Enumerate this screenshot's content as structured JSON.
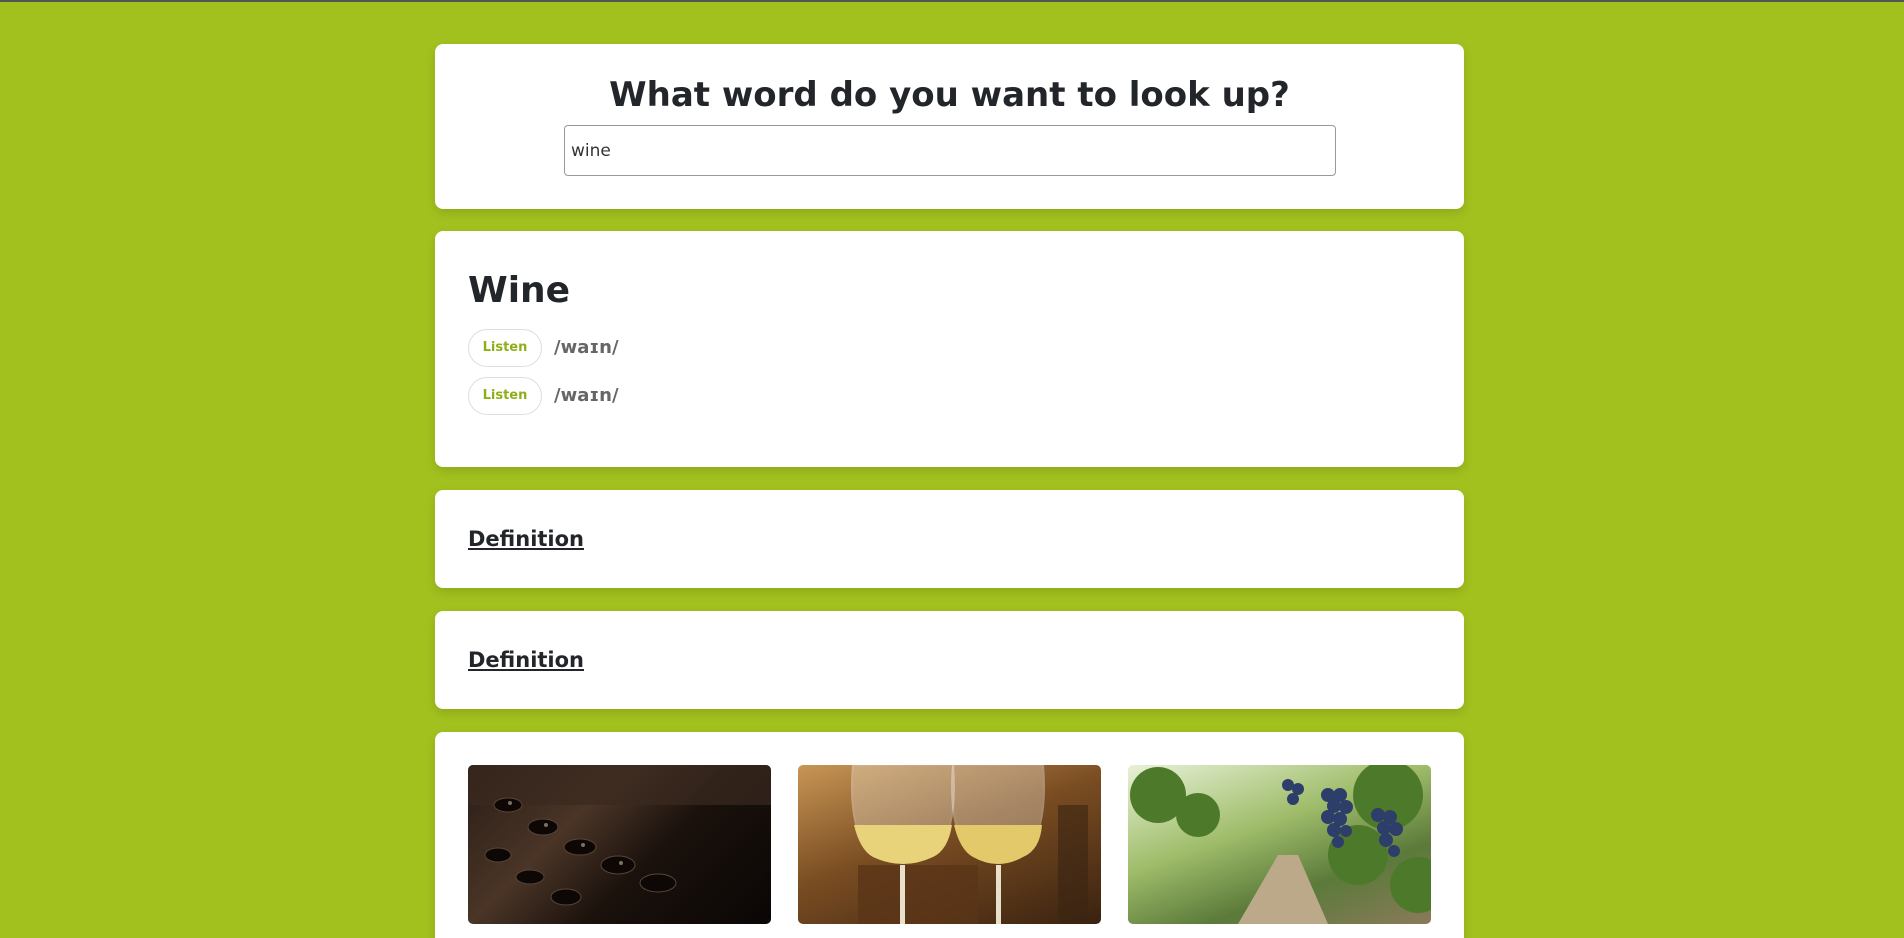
{
  "search": {
    "title": "What word do you want to look up?",
    "value": "wine"
  },
  "word": {
    "title": "Wine",
    "phonetics": [
      {
        "button_label": "Listen",
        "text": "/waɪn/"
      },
      {
        "button_label": "Listen",
        "text": "/waɪn/"
      }
    ]
  },
  "definitions": [
    {
      "heading": "Definition"
    },
    {
      "heading": "Definition"
    }
  ],
  "images": [
    {
      "icon": "wine-bottles-image"
    },
    {
      "icon": "wine-glasses-image"
    },
    {
      "icon": "grape-vineyard-image"
    }
  ],
  "colors": {
    "background": "#a2c11e",
    "accent": "#8db019",
    "card": "#ffffff"
  }
}
